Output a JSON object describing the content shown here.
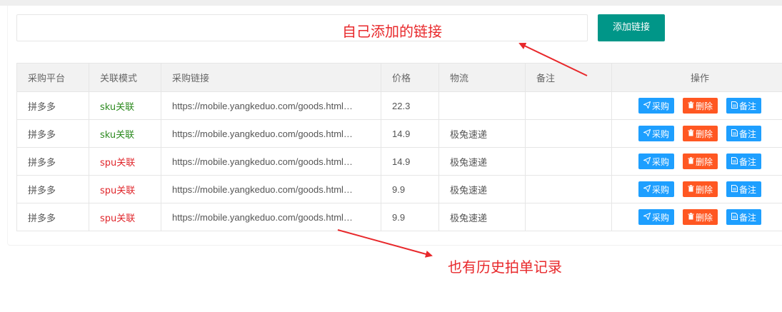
{
  "input": {
    "value": "",
    "placeholder": ""
  },
  "add_button": {
    "label": "添加链接"
  },
  "annotations": {
    "top": "自己添加的链接",
    "bottom": "也有历史拍单记录",
    "color": "#e8282b"
  },
  "table": {
    "headers": {
      "platform": "采购平台",
      "mode": "关联模式",
      "link": "采购链接",
      "price": "价格",
      "logistics": "物流",
      "note": "备注",
      "actions": "操作"
    },
    "actions": {
      "buy": "采购",
      "delete": "删除",
      "note": "备注"
    },
    "rows": [
      {
        "platform": "拼多多",
        "mode": "sku关联",
        "link": "https://mobile.yangkeduo.com/goods.html…",
        "price": "22.3",
        "logistics": "",
        "note": ""
      },
      {
        "platform": "拼多多",
        "mode": "sku关联",
        "link": "https://mobile.yangkeduo.com/goods.html…",
        "price": "14.9",
        "logistics": "极兔速递",
        "note": ""
      },
      {
        "platform": "拼多多",
        "mode": "spu关联",
        "link": "https://mobile.yangkeduo.com/goods.html…",
        "price": "14.9",
        "logistics": "极兔速递",
        "note": ""
      },
      {
        "platform": "拼多多",
        "mode": "spu关联",
        "link": "https://mobile.yangkeduo.com/goods.html…",
        "price": "9.9",
        "logistics": "极兔速递",
        "note": ""
      },
      {
        "platform": "拼多多",
        "mode": "spu关联",
        "link": "https://mobile.yangkeduo.com/goods.html…",
        "price": "9.9",
        "logistics": "极兔速递",
        "note": ""
      }
    ]
  },
  "colors": {
    "add_button": "#009688",
    "buy_button": "#1e9fff",
    "delete_button": "#ff5722",
    "note_button": "#1e9fff",
    "sku_text": "#2c8a1f",
    "spu_text": "#e0262b"
  },
  "icons": {
    "buy": "paper-plane-icon",
    "delete": "trash-icon",
    "note": "document-icon"
  }
}
